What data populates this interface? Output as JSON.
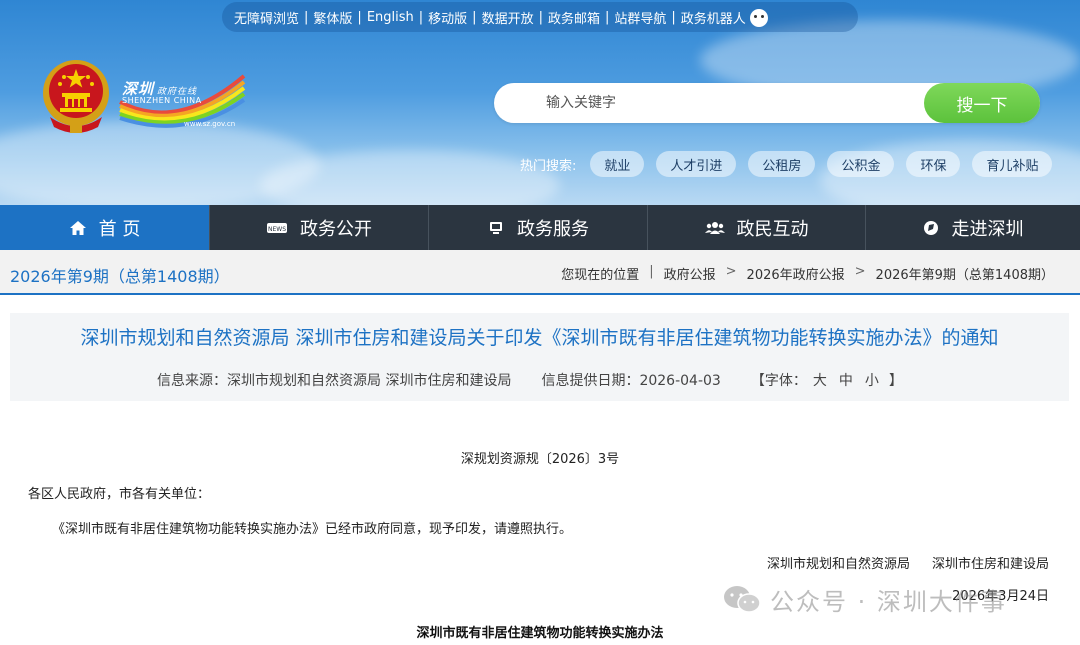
{
  "topbar": {
    "items": [
      "无障碍浏览",
      "繁体版",
      "English",
      "移动版",
      "数据开放",
      "政务邮箱",
      "站群导航",
      "政务机器人"
    ],
    "separator": "|"
  },
  "logo": {
    "cn_main": "深圳",
    "cn_sub": "政府在线",
    "en": "SHENZHEN CHINA",
    "url": "www.sz.gov.cn"
  },
  "search": {
    "placeholder": "输入关键字",
    "button_label": "搜一下",
    "hot_label": "热门搜索:",
    "hot_tags": [
      "就业",
      "人才引进",
      "公租房",
      "公积金",
      "环保",
      "育儿补贴"
    ]
  },
  "nav": {
    "items": [
      {
        "label": "首 页",
        "icon": "home-icon"
      },
      {
        "label": "政务公开",
        "icon": "news-icon"
      },
      {
        "label": "政务服务",
        "icon": "monitor-icon"
      },
      {
        "label": "政民互动",
        "icon": "people-icon"
      },
      {
        "label": "走进深圳",
        "icon": "compass-icon"
      }
    ]
  },
  "breadcrumb": {
    "issue": "2026年第9期（总第1408期）",
    "location_label": "您现在的位置",
    "items": [
      "政府公报",
      "2026年政府公报",
      "2026年第9期（总第1408期）"
    ],
    "separator": ">"
  },
  "article": {
    "title": "深圳市规划和自然资源局 深圳市住房和建设局关于印发《深圳市既有非居住建筑物功能转换实施办法》的通知",
    "source": "信息来源：深圳市规划和自然资源局 深圳市住房和建设局",
    "date": "信息提供日期：2026-04-03",
    "font_label_open": "【字体：",
    "font_sizes": [
      "大",
      "中",
      "小"
    ],
    "font_label_close": "】",
    "doc_number": "深规划资源规〔2026〕3号",
    "addressee": "各区人民政府，市各有关单位：",
    "paragraph": "《深圳市既有非居住建筑物功能转换实施办法》已经市政府同意，现予印发，请遵照执行。",
    "issuers": [
      "深圳市规划和自然资源局",
      "深圳市住房和建设局"
    ],
    "signed_date": "2026年3月24日",
    "attachment_title": "深圳市既有非居住建筑物功能转换实施办法"
  },
  "watermark": {
    "text": "公众号 · 深圳大件事"
  }
}
